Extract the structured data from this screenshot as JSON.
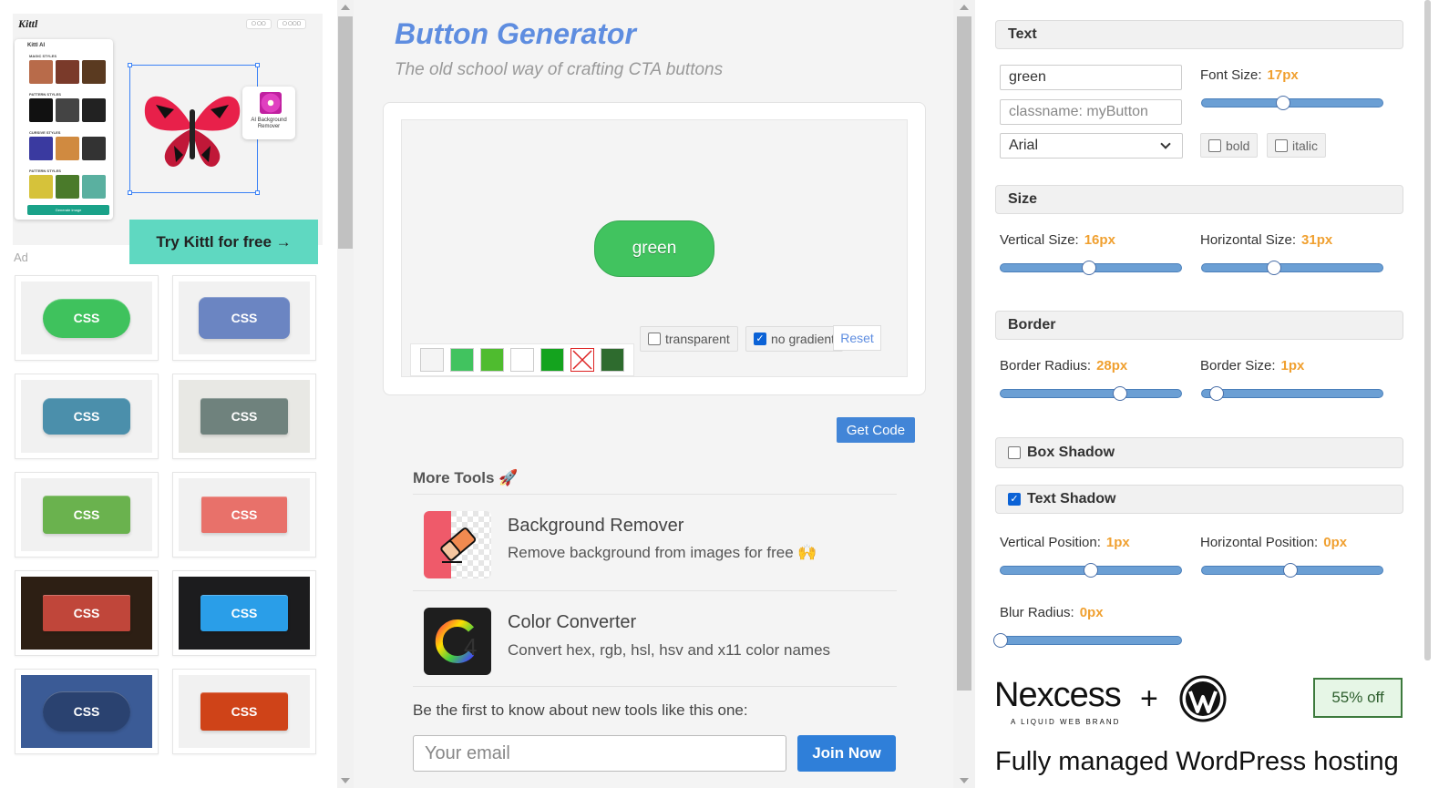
{
  "left": {
    "ad": {
      "logo": "Kittl",
      "cta": "Try Kittl for free →",
      "panel_title": "Kittl AI",
      "sections": [
        "MAGIC STYLES",
        "PATTERN STYLES",
        "CURSIVE STYLES",
        "PATTERN STYLES"
      ],
      "ai_card_label": "AI Background Remover",
      "cta_small": "Generate image"
    },
    "ad_label": "Ad",
    "thumbnails": [
      {
        "label": "CSS",
        "bg": "#f1f1f1",
        "color": "#3fc25d",
        "w": 96,
        "h": 43,
        "radius": 22
      },
      {
        "label": "CSS",
        "bg": "#f1f1f1",
        "color": "#6b85c2",
        "w": 100,
        "h": 46,
        "radius": 8
      },
      {
        "label": "CSS",
        "bg": "#f1f1f1",
        "color": "#4b8fab",
        "w": 96,
        "h": 40,
        "radius": 8
      },
      {
        "label": "CSS",
        "bg": "#e8e8e4",
        "color": "#6f827d",
        "w": 96,
        "h": 40,
        "radius": 3
      },
      {
        "label": "CSS",
        "bg": "#f1f1f1",
        "color": "#6ab24e",
        "w": 96,
        "h": 42,
        "radius": 4
      },
      {
        "label": "CSS",
        "bg": "#f1f1f1",
        "color": "#e8716a",
        "w": 94,
        "h": 40,
        "radius": 2
      },
      {
        "label": "CSS",
        "bg": "#2d1f14",
        "color": "#c0463a",
        "w": 96,
        "h": 40,
        "radius": 2
      },
      {
        "label": "CSS",
        "bg": "#1c1c1e",
        "color": "#2a9ee8",
        "w": 96,
        "h": 40,
        "radius": 3
      },
      {
        "label": "CSS",
        "bg": "#3b5b96",
        "color": "#2a4270",
        "w": 96,
        "h": 44,
        "radius": 22
      },
      {
        "label": "CSS",
        "bg": "#f1f1f1",
        "color": "#cf4318",
        "w": 96,
        "h": 42,
        "radius": 3
      }
    ]
  },
  "middle": {
    "title": "Button Generator",
    "subtitle": "The old school way of crafting CTA buttons",
    "preview_button_text": "green",
    "swatches": [
      "#f4f4f4",
      "#41c35f",
      "#4fbc2f",
      "#ffffff",
      "#14a31e",
      "none",
      "#2e6b2e"
    ],
    "transparent_label": "transparent",
    "no_gradient_label": "no gradient",
    "reset_label": "Reset",
    "get_code_label": "Get Code",
    "more_tools_label": "More Tools 🚀",
    "tools": [
      {
        "title": "Background Remover",
        "desc": "Remove background from images for free 🙌"
      },
      {
        "title": "Color Converter",
        "desc": "Convert hex, rgb, hsl, hsv and x11 color names"
      }
    ],
    "newsletter_text": "Be the first to know about new tools like this one:",
    "email_placeholder": "Your email",
    "join_label": "Join Now"
  },
  "right": {
    "text_section": {
      "title": "Text",
      "text_value": "green",
      "classname_placeholder": "classname: myButton",
      "font": "Arial",
      "font_size_label": "Font Size:",
      "font_size_value": "17px",
      "font_size_fraction": 0.45,
      "bold_label": "bold",
      "italic_label": "italic"
    },
    "size_section": {
      "title": "Size",
      "vertical_label": "Vertical Size:",
      "vertical_value": "16px",
      "vertical_fraction": 0.49,
      "horizontal_label": "Horizontal Size:",
      "horizontal_value": "31px",
      "horizontal_fraction": 0.4
    },
    "border_section": {
      "title": "Border",
      "radius_label": "Border Radius:",
      "radius_value": "28px",
      "radius_fraction": 0.66,
      "size_label": "Border Size:",
      "size_value": "1px",
      "size_fraction": 0.08
    },
    "box_shadow_label": "Box Shadow",
    "text_shadow_section": {
      "title": "Text Shadow",
      "vpos_label": "Vertical Position:",
      "vpos_value": "1px",
      "vpos_fraction": 0.5,
      "hpos_label": "Horizontal Position:",
      "hpos_value": "0px",
      "hpos_fraction": 0.49,
      "blur_label": "Blur Radius:",
      "blur_value": "0px",
      "blur_fraction": 0.0
    },
    "ad": {
      "brand": "Nexcess",
      "brand_sub": "A LIQUID WEB BRAND",
      "plus": "+",
      "discount": "55% off",
      "headline": "Fully managed WordPress hosting"
    }
  }
}
